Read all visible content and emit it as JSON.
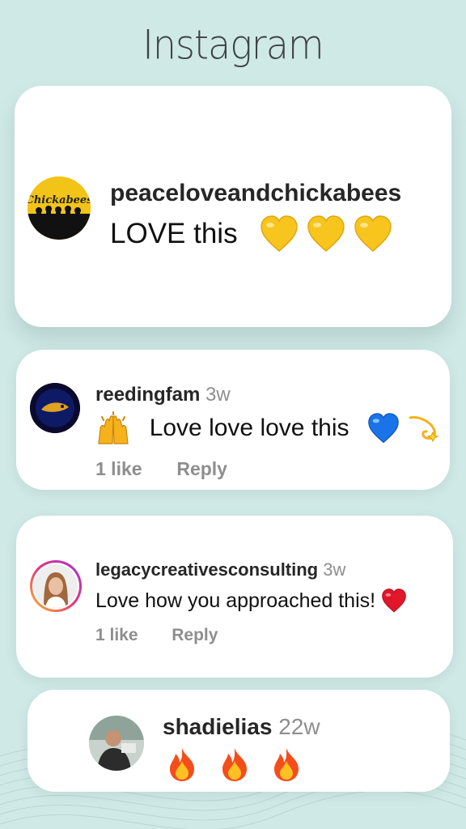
{
  "header": {
    "title": "Instagram"
  },
  "comments": [
    {
      "username": "peaceloveandchickabees",
      "time": "",
      "text": "LOVE this",
      "emojis": [
        "yellow-heart",
        "yellow-heart",
        "yellow-heart"
      ],
      "avatar_text": "Chickabees",
      "likes": "",
      "reply": ""
    },
    {
      "username": "reedingfam",
      "time": "3w",
      "text": "Love love love this",
      "lead_emoji": "raising-hands",
      "emojis": [
        "blue-heart",
        "dizzy"
      ],
      "likes": "1 like",
      "reply": "Reply"
    },
    {
      "username": "legacycreativesconsulting",
      "time": "3w",
      "text": "Love how you approached this!",
      "emojis": [
        "red-heart"
      ],
      "likes": "1 like",
      "reply": "Reply"
    },
    {
      "username": "shadielias",
      "time": "22w",
      "text": "",
      "emojis": [
        "fire",
        "fire",
        "fire"
      ],
      "likes": "",
      "reply": ""
    }
  ],
  "colors": {
    "background": "#cfe9e6",
    "card": "#ffffff",
    "muted": "#8e8e8e",
    "yellow_heart": "#f7c51e",
    "blue_heart": "#1a73e8",
    "red_heart": "#e0162b"
  }
}
